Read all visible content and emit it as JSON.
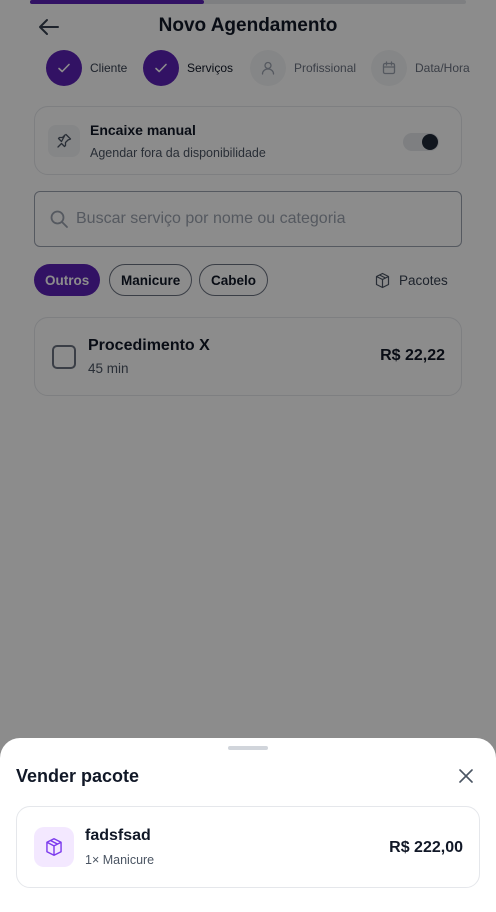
{
  "header": {
    "title": "Novo Agendamento",
    "progress_fraction": 0.4
  },
  "steps": [
    {
      "label": "Cliente",
      "state": "done",
      "icon": "check-icon"
    },
    {
      "label": "Serviços",
      "state": "active",
      "icon": "check-icon"
    },
    {
      "label": "Profissional",
      "state": "pending",
      "icon": "user-icon"
    },
    {
      "label": "Data/Hora",
      "state": "pending",
      "icon": "calendar-icon"
    }
  ],
  "encaixe": {
    "title": "Encaixe manual",
    "subtitle": "Agendar fora da disponibilidade",
    "icon": "pin-icon",
    "enabled": false
  },
  "search": {
    "placeholder": "Buscar serviço por nome ou categoria",
    "value": ""
  },
  "categories": [
    {
      "label": "Outros",
      "active": true
    },
    {
      "label": "Manicure",
      "active": false
    },
    {
      "label": "Cabelo",
      "active": false
    }
  ],
  "pacotes_button": {
    "label": "Pacotes",
    "icon": "package-icon"
  },
  "services": [
    {
      "name": "Procedimento X",
      "duration": "45 min",
      "price": "R$ 22,22",
      "checked": false
    }
  ],
  "sheet": {
    "title": "Vender pacote",
    "packages": [
      {
        "name": "fadsfsad",
        "items": "1× Manicure",
        "price": "R$ 222,00",
        "icon": "package-icon"
      }
    ]
  },
  "colors": {
    "accent": "#5b21b6",
    "package_icon_bg": "#f3e8ff",
    "overlay": "rgba(0,0,0,0.45)"
  }
}
